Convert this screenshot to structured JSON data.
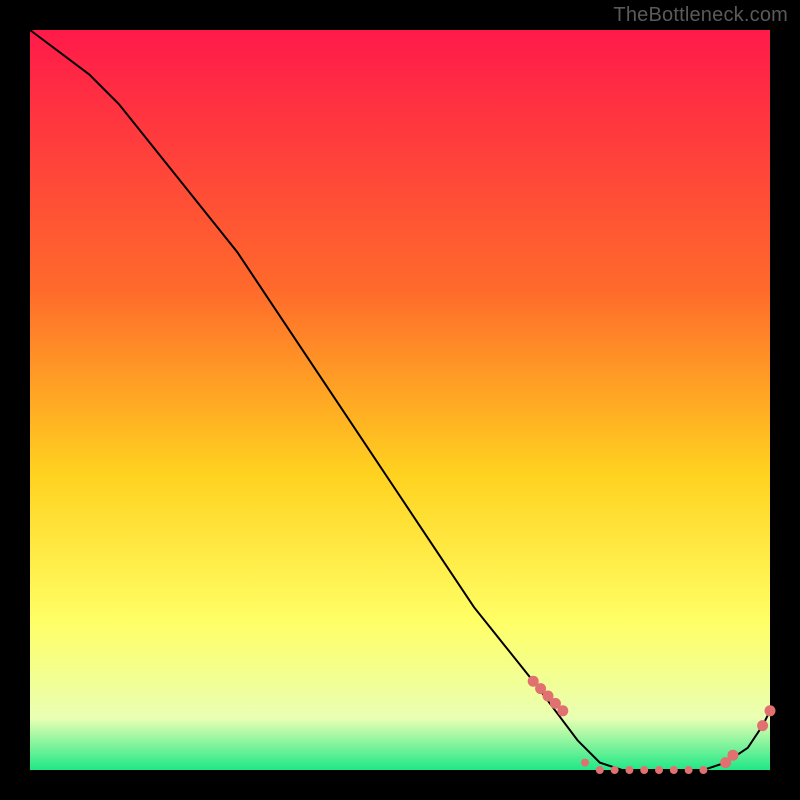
{
  "watermark": "TheBottleneck.com",
  "colors": {
    "bg": "#000000",
    "grad_top": "#ff1a4a",
    "grad_mid1": "#ff6a2b",
    "grad_mid2": "#ffd21f",
    "grad_mid3": "#ffff66",
    "grad_mid4": "#e9ffb3",
    "grad_bottom": "#1fe887",
    "curve": "#000000",
    "marker": "#e17070",
    "watermark_color": "#5a5a5a"
  },
  "chart_data": {
    "type": "line",
    "title": "",
    "xlabel": "",
    "ylabel": "",
    "xlim": [
      0,
      100
    ],
    "ylim": [
      0,
      100
    ],
    "series": [
      {
        "name": "bottleneck-curve",
        "x": [
          0,
          4,
          8,
          12,
          16,
          20,
          24,
          28,
          32,
          36,
          40,
          44,
          48,
          52,
          56,
          60,
          64,
          68,
          71,
          74,
          77,
          80,
          83,
          86,
          89,
          91,
          94,
          97,
          99,
          100
        ],
        "y": [
          100,
          97,
          94,
          90,
          85,
          80,
          75,
          70,
          64,
          58,
          52,
          46,
          40,
          34,
          28,
          22,
          17,
          12,
          8,
          4,
          1,
          0,
          0,
          0,
          0,
          0,
          1,
          3,
          6,
          8
        ]
      }
    ],
    "markers": [
      {
        "name": "cluster-left",
        "x": [
          68,
          69,
          70,
          71,
          72
        ],
        "y": [
          12,
          11,
          10,
          9,
          8
        ]
      },
      {
        "name": "flat-run",
        "x": [
          75,
          77,
          79,
          81,
          83,
          85,
          87,
          89,
          91
        ],
        "y": [
          1,
          0,
          0,
          0,
          0,
          0,
          0,
          0,
          0
        ]
      },
      {
        "name": "rise-right",
        "x": [
          94,
          95,
          99,
          100
        ],
        "y": [
          1,
          2,
          6,
          8
        ]
      }
    ],
    "gradient_zones": [
      {
        "label": "red",
        "from": 100,
        "to": 60
      },
      {
        "label": "orange",
        "from": 60,
        "to": 40
      },
      {
        "label": "yellow",
        "from": 40,
        "to": 18
      },
      {
        "label": "pale",
        "from": 18,
        "to": 6
      },
      {
        "label": "green",
        "from": 6,
        "to": 0
      }
    ]
  }
}
